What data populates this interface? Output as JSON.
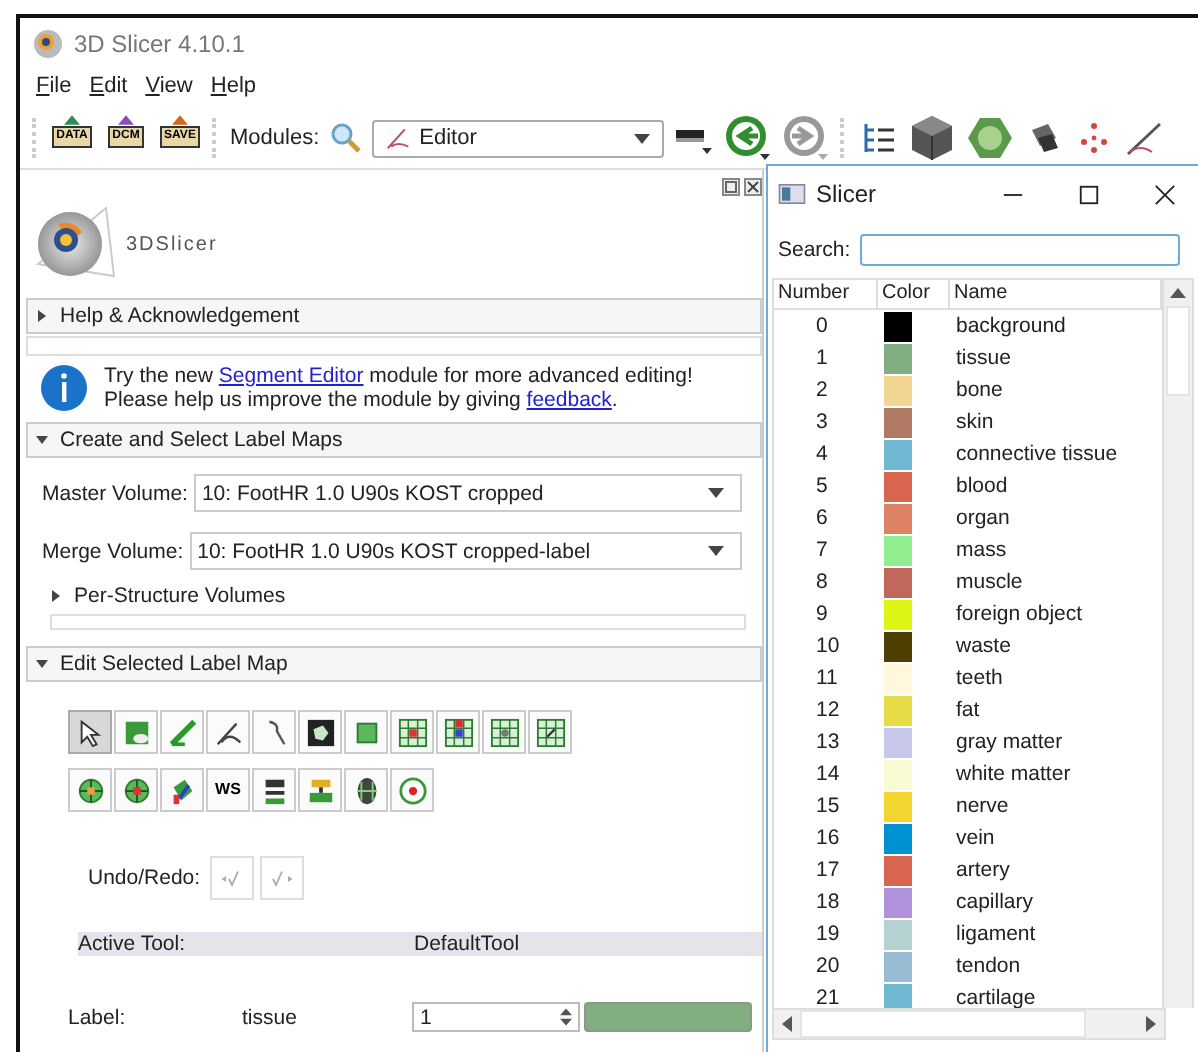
{
  "window": {
    "title": "3D Slicer 4.10.1"
  },
  "menu": [
    "File",
    "Edit",
    "View",
    "Help"
  ],
  "toolbar": {
    "file_buttons": [
      "DATA",
      "DCM",
      "SAVE"
    ],
    "modules_label": "Modules:",
    "module": "Editor"
  },
  "panel": {
    "logo_text": "3DSlicer",
    "sections": [
      {
        "title": "Help & Acknowledgement",
        "expanded": false
      }
    ],
    "notice": {
      "line1_before": "Try the new ",
      "link1": "Segment Editor",
      "line1_after": " module for more advanced editing!",
      "line2_before": "Please help us improve the module by giving ",
      "link2": "feedback",
      "line2_after": "."
    },
    "create_section": {
      "title": "Create and Select Label Maps",
      "expanded": true
    },
    "master_volume": {
      "label": "Master Volume:",
      "value": "10: FootHR  1.0  U90s KOST cropped"
    },
    "merge_volume": {
      "label": "Merge Volume:",
      "value": "10: FootHR  1.0  U90s KOST cropped-label"
    },
    "per_structure": {
      "title": "Per-Structure Volumes",
      "expanded": false
    },
    "edit_section": {
      "title": "Edit Selected Label Map",
      "expanded": true
    },
    "tools_row1": [
      {
        "selected": true
      },
      {
        "selected": false
      },
      {
        "selected": false
      },
      {
        "selected": false
      },
      {
        "selected": false
      },
      {
        "selected": false
      },
      {
        "selected": false
      },
      {
        "selected": false
      },
      {
        "selected": false
      },
      {
        "selected": false
      },
      {
        "selected": false
      }
    ],
    "tools_row2": [
      {
        "selected": false
      },
      {
        "selected": false
      },
      {
        "selected": false
      },
      {
        "selected": false,
        "text": "WS"
      },
      {
        "selected": false
      },
      {
        "selected": false
      },
      {
        "selected": false
      },
      {
        "selected": false
      }
    ],
    "undo_redo_label": "Undo/Redo:",
    "active_tool": {
      "label": "Active Tool:",
      "value": "DefaultTool"
    },
    "label_row": {
      "label": "Label:",
      "name": "tissue",
      "value": "1",
      "color": "#80ae80"
    }
  },
  "color_window": {
    "title": "Slicer",
    "search_label": "Search:",
    "columns": [
      "Number",
      "Color",
      "Name"
    ],
    "rows": [
      {
        "number": "0",
        "color": "#000000",
        "name": "background"
      },
      {
        "number": "1",
        "color": "#80ae80",
        "name": "tissue"
      },
      {
        "number": "2",
        "color": "#f1d691",
        "name": "bone"
      },
      {
        "number": "3",
        "color": "#b17a65",
        "name": "skin"
      },
      {
        "number": "4",
        "color": "#6fb8d2",
        "name": "connective tissue"
      },
      {
        "number": "5",
        "color": "#d8654f",
        "name": "blood"
      },
      {
        "number": "6",
        "color": "#dd8265",
        "name": "organ"
      },
      {
        "number": "7",
        "color": "#90ee90",
        "name": "mass"
      },
      {
        "number": "8",
        "color": "#c0685c",
        "name": "muscle"
      },
      {
        "number": "9",
        "color": "#dcf514",
        "name": "foreign object"
      },
      {
        "number": "10",
        "color": "#4e3f00",
        "name": "waste"
      },
      {
        "number": "11",
        "color": "#fff8dc",
        "name": "teeth"
      },
      {
        "number": "12",
        "color": "#e6dc46",
        "name": "fat"
      },
      {
        "number": "13",
        "color": "#c8c8eb",
        "name": "gray matter"
      },
      {
        "number": "14",
        "color": "#f9f9d2",
        "name": "white matter"
      },
      {
        "number": "15",
        "color": "#f4d631",
        "name": "nerve"
      },
      {
        "number": "16",
        "color": "#0091d2",
        "name": "vein"
      },
      {
        "number": "17",
        "color": "#d8654f",
        "name": "artery"
      },
      {
        "number": "18",
        "color": "#b193dd",
        "name": "capillary"
      },
      {
        "number": "19",
        "color": "#b4d2d2",
        "name": "ligament"
      },
      {
        "number": "20",
        "color": "#97bcd3",
        "name": "tendon"
      },
      {
        "number": "21",
        "color": "#6fb8d2",
        "name": "cartilage"
      }
    ]
  }
}
